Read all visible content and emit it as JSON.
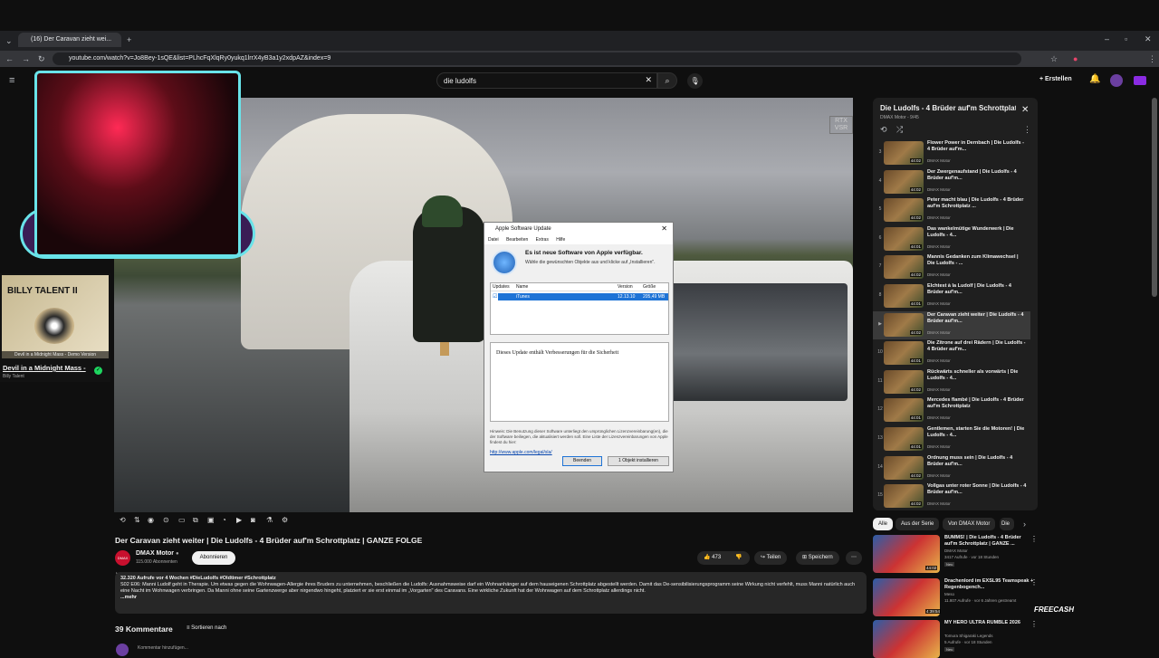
{
  "browser": {
    "tab_title": "(16) Der Caravan zieht wei...",
    "url": "youtube.com/watch?v=Jo8Bey-1sQE&list=PLhcFqXlqRy0yukq1lrrX4yB3a1y2xdpAZ&index=9"
  },
  "header": {
    "search_value": "die ludolfs",
    "create_label": "Erstellen",
    "notifications": "9+"
  },
  "video": {
    "rtx_badge": "RTX VSR",
    "title": "Der Caravan zieht weiter | Die Ludolfs - 4 Brüder auf'm Schrottplatz | GANZE FOLGE",
    "channel": "DMAX Motor",
    "channel_logo": "DMAX MOTOR",
    "subscribers": "115.000 Abonnenten",
    "subscribe_label": "Abonnieren",
    "likes": "473",
    "share_label": "Teilen",
    "save_label": "Speichern",
    "desc_meta": "32.320 Aufrufe  vor 4 Wochen  #DieLudolfs #Oldtimer #Schrottplatz",
    "desc_text": "S02 E06: Manni Ludolf geht in Therapie. Um etwas gegen die Wohnwagen-Allergie ihres Bruders zu unternehmen, beschließen die Ludolfs: Ausnahmsweise darf ein Wohnanhänger auf dem hauseigenen Schrottplatz abgestellt werden. Damit das De-sensibilisierungsprogramm seine Wirkung nicht verfehlt, muss Manni natürlich auch eine Nacht im Wohnwagen verbringen. Da Manni ohne seine Gartenzwerge aber nirgendwo hingeht, platziert er sie erst einmal im „Vorgarten\" des Caravans. Eine wirkliche Zukunft hat der Wohnwagen auf dem Schrottplatz allerdings nicht.",
    "more_label": "...mehr",
    "comments_count": "39 Kommentare",
    "sort_label": "Sortieren nach",
    "add_comment": "Kommentar hinzufügen..."
  },
  "dialog": {
    "title": "Apple Software Update",
    "menu": [
      "Datei",
      "Bearbeiten",
      "Extras",
      "Hilfe"
    ],
    "heading": "Es ist neue Software von Apple verfügbar.",
    "subheading": "Wähle die gewünschten Objekte aus und klicke auf „Installieren\".",
    "col_updates": "Updates",
    "col_name": "Name",
    "col_version": "Version",
    "col_size": "Größe",
    "row_name": "iTunes",
    "row_version": "12.13.10",
    "row_size": "205,49 MB",
    "description": "Dieses Update enthält Verbesserungen für die Sicherheit",
    "note": "Hinweis: Die Benutzung dieser Software unterliegt den ursprünglichen Lizenzvereinbarung(en), die der Software beiliegen, die aktualisiert werden soll. Eine Liste der Lizenzvereinbarungen von Apple findest du hier:",
    "link": "http://www.apple.com/legal/sla/",
    "btn_quit": "Beenden",
    "btn_install": "1 Objekt installieren"
  },
  "spotify": {
    "album_text": "BILLY TALENT II",
    "demo_line": "Devil in a Midnight Mass - Demo Version",
    "song": "Devil in a Midnight Mass -",
    "artist": "Billy Talent"
  },
  "playlist": {
    "title": "Die Ludolfs - 4 Brüder auf'm Schrottplatz",
    "subtitle": "DMAX Motor - 9/45",
    "items": [
      {
        "num": "3",
        "title": "Flower Power in Dernbach | Die Ludolfs - 4 Brüder auf'm...",
        "channel": "DMAX Motor",
        "dur": "44:02"
      },
      {
        "num": "4",
        "title": "Der Zwergenaufstand | Die Ludolfs - 4 Brüder auf'm...",
        "channel": "DMAX Motor",
        "dur": "44:02"
      },
      {
        "num": "5",
        "title": "Peter macht blau | Die Ludolfs - 4 Brüder auf'm Schrottplatz ...",
        "channel": "DMAX Motor",
        "dur": "44:02"
      },
      {
        "num": "6",
        "title": "Das wankelmütige Wunderwerk | Die Ludolfs - 4...",
        "channel": "DMAX Motor",
        "dur": "44:01"
      },
      {
        "num": "7",
        "title": "Mannis Gedanken zum Klimawechsel | Die Ludolfs - ...",
        "channel": "DMAX Motor",
        "dur": "44:02"
      },
      {
        "num": "8",
        "title": "Elchtest à la Ludolf | Die Ludolfs - 4 Brüder auf'm...",
        "channel": "DMAX Motor",
        "dur": "44:01"
      },
      {
        "num": "▶",
        "title": "Der Caravan zieht weiter | Die Ludolfs - 4 Brüder auf'm...",
        "channel": "DMAX Motor",
        "dur": "44:02"
      },
      {
        "num": "10",
        "title": "Die Zitrone auf drei Rädern | Die Ludolfs - 4 Brüder auf'm...",
        "channel": "DMAX Motor",
        "dur": "44:01"
      },
      {
        "num": "11",
        "title": "Rückwärts schneller als vorwärts | Die Ludolfs - 4...",
        "channel": "DMAX Motor",
        "dur": "44:02"
      },
      {
        "num": "12",
        "title": "Mercedes flambé | Die Ludolfs - 4 Brüder auf'm Schrottplatz",
        "channel": "DMAX Motor",
        "dur": "44:01"
      },
      {
        "num": "13",
        "title": "Gentlemen, starten Sie die Motoren! | Die Ludolfs - 4...",
        "channel": "DMAX Motor",
        "dur": "44:01"
      },
      {
        "num": "14",
        "title": "Ordnung muss sein | Die Ludolfs - 4 Brüder auf'm...",
        "channel": "DMAX Motor",
        "dur": "44:02"
      },
      {
        "num": "15",
        "title": "Vollgas unter roter Sonne | Die Ludolfs - 4 Brüder auf'm...",
        "channel": "DMAX Motor",
        "dur": "44:02"
      }
    ]
  },
  "chips": [
    "Alle",
    "Aus der Serie",
    "Von DMAX Motor",
    "Die"
  ],
  "recommendations": [
    {
      "title": "BUMMS! | Die Ludolfs - 4 Brüder auf'm Schrottplatz | GANZE ...",
      "channel": "DMAX Motor",
      "meta": "3417 Aufrufe · vor 18 Stunden",
      "badge": "Neu",
      "dur": "44:02"
    },
    {
      "title": "Drachenlord im EXSL95 Teamspeak + Regenbogench...",
      "channel": "Meso",
      "meta": "11.807 Aufrufe · vor 6 Jahren gestreamt",
      "badge": "",
      "dur": "4:39:54"
    },
    {
      "title": "MY HERO ULTRA RUMBLE 2026",
      "channel": "Tomura Shigaraki Legends",
      "meta": "5 Aufrufe · vor 18 Stunden",
      "badge": "Neu",
      "dur": ""
    }
  ],
  "freecash": "FREECASH"
}
